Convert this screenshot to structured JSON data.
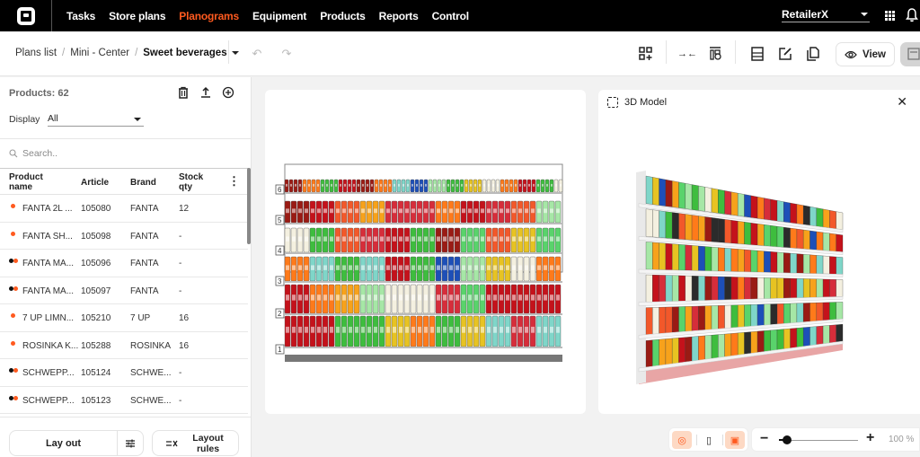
{
  "topbar": {
    "nav": [
      {
        "label": "Tasks",
        "active": false
      },
      {
        "label": "Store plans",
        "active": false
      },
      {
        "label": "Planograms",
        "active": true
      },
      {
        "label": "Equipment",
        "active": false
      },
      {
        "label": "Products",
        "active": false
      },
      {
        "label": "Reports",
        "active": false
      },
      {
        "label": "Control",
        "active": false
      }
    ],
    "retailer": "RetailerX",
    "accent": "#ff5a1f"
  },
  "toolbar": {
    "breadcrumb": [
      "Plans list",
      "Mini - Center",
      "Sweet beverages"
    ],
    "view_label": "View",
    "icons": [
      "undo-icon",
      "redo-icon",
      "add-grid-icon",
      "compress-icon",
      "shelf-settings-icon",
      "fixture-icon",
      "edit-icon",
      "copy-icon",
      "eye-icon",
      "save-icon"
    ]
  },
  "left": {
    "products_label": "Products: 62",
    "display_label": "Display",
    "display_value": "All",
    "search_placeholder": "Search..",
    "columns": {
      "name": "Product name",
      "article": "Article",
      "brand": "Brand",
      "stock": "Stock qty"
    },
    "rows": [
      {
        "name": "FANTA 2L ...",
        "article": "105080",
        "brand": "FANTA",
        "stock": "12",
        "status": "single"
      },
      {
        "name": "FANTA SH...",
        "article": "105098",
        "brand": "FANTA",
        "stock": "-",
        "status": "single"
      },
      {
        "name": "FANTA MA...",
        "article": "105096",
        "brand": "FANTA",
        "stock": "-",
        "status": "double"
      },
      {
        "name": "FANTA MA...",
        "article": "105097",
        "brand": "FANTA",
        "stock": "-",
        "status": "double"
      },
      {
        "name": "7 UP LIMN...",
        "article": "105210",
        "brand": "7 UP",
        "stock": "16",
        "status": "single"
      },
      {
        "name": "ROSINKA K...",
        "article": "105288",
        "brand": "ROSINKA",
        "stock": "16",
        "status": "single"
      },
      {
        "name": "SCHWEPP...",
        "article": "105124",
        "brand": "SCHWE...",
        "stock": "-",
        "status": "double"
      },
      {
        "name": "SCHWEPP...",
        "article": "105123",
        "brand": "SCHWE...",
        "stock": "-",
        "status": "double"
      }
    ],
    "lay_out_label": "Lay out",
    "layout_rules_label": "Layout rules"
  },
  "planogram": {
    "shelf_numbers": [
      "6",
      "5",
      "4",
      "3",
      "2",
      "1"
    ]
  },
  "model": {
    "title": "3D Model"
  },
  "zoom": {
    "minus": "−",
    "plus": "+",
    "level_label": "100 %",
    "level_fraction": 0.1
  }
}
